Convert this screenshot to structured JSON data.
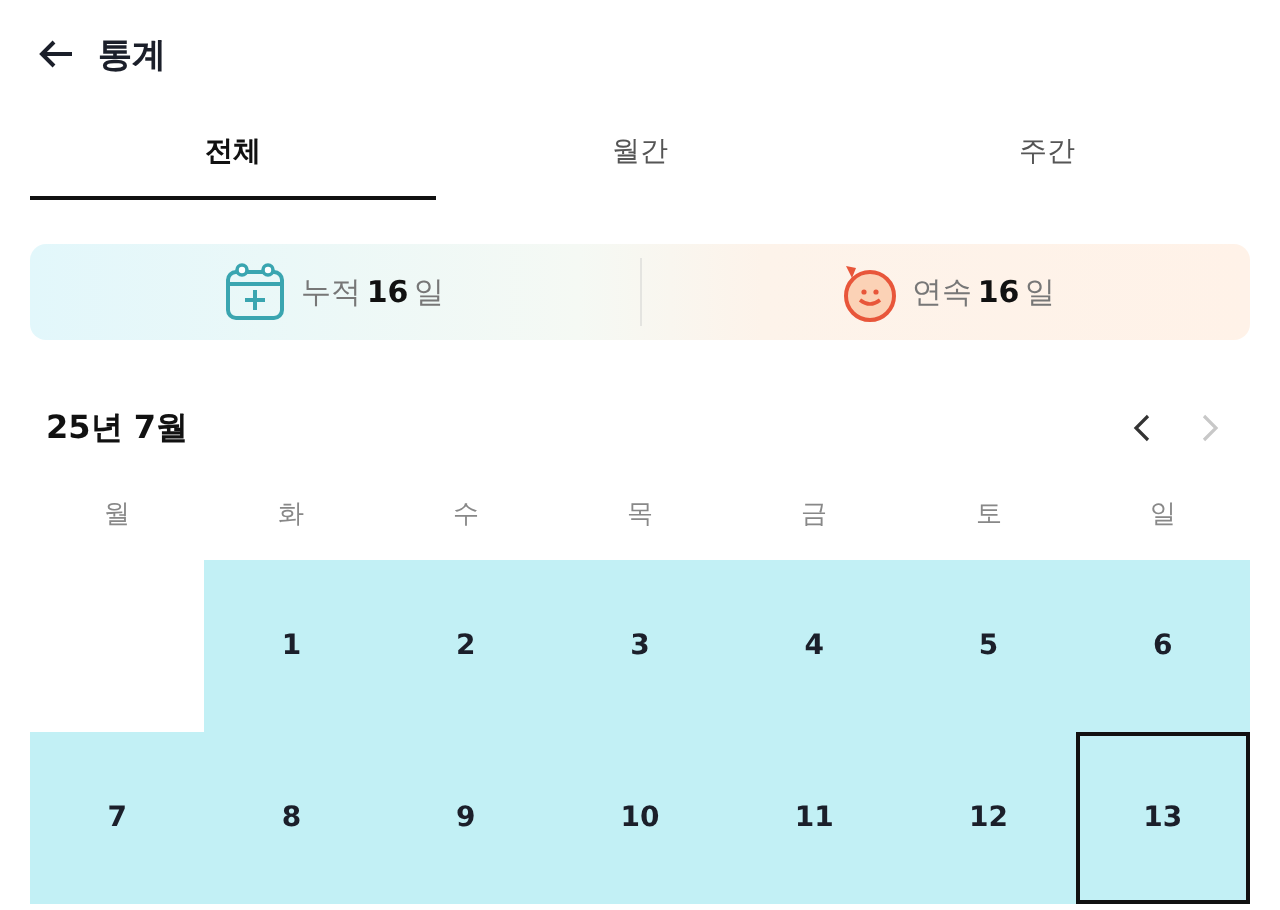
{
  "header": {
    "title": "통계"
  },
  "tabs": [
    {
      "label": "전체",
      "selected": true
    },
    {
      "label": "월간",
      "selected": false
    },
    {
      "label": "주간",
      "selected": false
    }
  ],
  "stats": [
    {
      "kind": "total",
      "label": "누적",
      "value": "16",
      "unit": "일"
    },
    {
      "kind": "streak",
      "label": "연속",
      "value": "16",
      "unit": "일"
    }
  ],
  "calendar": {
    "title": "25년 7월",
    "prev_disabled": false,
    "next_disabled": true,
    "weekdays": [
      "월",
      "화",
      "수",
      "목",
      "금",
      "토",
      "일"
    ],
    "weeks": [
      [
        {
          "kind": "blank"
        },
        {
          "kind": "day",
          "day": "1",
          "marked": true,
          "selected": false
        },
        {
          "kind": "day",
          "day": "2",
          "marked": true,
          "selected": false
        },
        {
          "kind": "day",
          "day": "3",
          "marked": true,
          "selected": false
        },
        {
          "kind": "day",
          "day": "4",
          "marked": true,
          "selected": false
        },
        {
          "kind": "day",
          "day": "5",
          "marked": true,
          "selected": false
        },
        {
          "kind": "day",
          "day": "6",
          "marked": true,
          "selected": false
        }
      ],
      [
        {
          "kind": "day",
          "day": "7",
          "marked": true,
          "selected": false
        },
        {
          "kind": "day",
          "day": "8",
          "marked": true,
          "selected": false
        },
        {
          "kind": "day",
          "day": "9",
          "marked": true,
          "selected": false
        },
        {
          "kind": "day",
          "day": "10",
          "marked": true,
          "selected": false
        },
        {
          "kind": "day",
          "day": "11",
          "marked": true,
          "selected": false
        },
        {
          "kind": "day",
          "day": "12",
          "marked": true,
          "selected": false
        },
        {
          "kind": "day",
          "day": "13",
          "marked": true,
          "selected": true
        }
      ]
    ]
  }
}
